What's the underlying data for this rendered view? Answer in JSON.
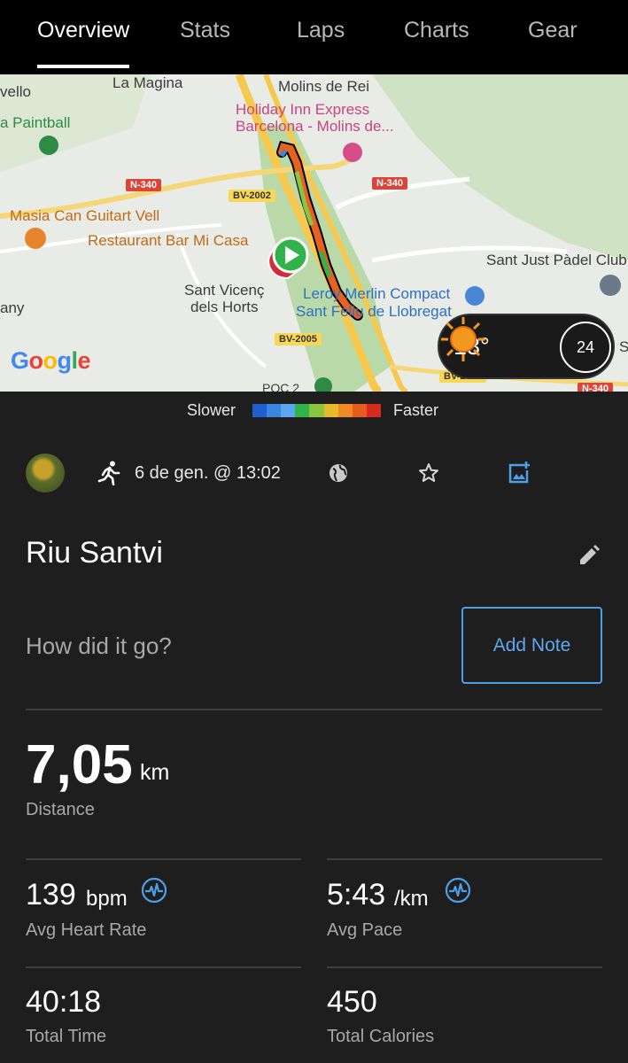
{
  "tabs": [
    {
      "label": "Overview",
      "active": true
    },
    {
      "label": "Stats"
    },
    {
      "label": "Laps"
    },
    {
      "label": "Charts"
    },
    {
      "label": "Gear"
    }
  ],
  "map": {
    "labels": {
      "la_magina": "La Magina",
      "molins_de_rei": "Molins de Rei",
      "vello": "vello",
      "paintball": "a Paintball",
      "holiday_inn_1": "Holiday Inn Express",
      "holiday_inn_2": "Barcelona - Molins de...",
      "masia": "Masia Can Guitart Vell",
      "restaurant": "Restaurant Bar Mi Casa",
      "sant_vicenc_1": "Sant Vicenç",
      "sant_vicenc_2": "dels Horts",
      "leroy_1": "Leroy Merlin Compact",
      "leroy_2": "Sant Feliu de Llobregat",
      "sant_just": "Sant Just Pàdel Club",
      "any": "any",
      "s_edge": "S"
    },
    "road_shields": {
      "n340_a": "N-340",
      "n340_b": "N-340",
      "n340_c": "N-340",
      "bv2002": "BV-2002",
      "bv2005": "BV-2005",
      "bv2001": "BV-2001",
      "poc": "POC 2"
    },
    "google_logo": "Google",
    "weather": {
      "temperature": "13°",
      "moon_phase_day": "24"
    }
  },
  "legend": {
    "slower": "Slower",
    "faster": "Faster",
    "colors": [
      "#1f5fd0",
      "#3b86e0",
      "#5aa7ef",
      "#2fb34a",
      "#8bc53f",
      "#e7b92d",
      "#f08a24",
      "#e65b1e",
      "#d62a1f"
    ]
  },
  "activity": {
    "date": "6 de gen. @ 13:02",
    "title": "Riu Santvi",
    "prompt": "How did it go?",
    "add_note_label": "Add Note",
    "distance": {
      "value": "7,05",
      "unit": "km",
      "label": "Distance"
    },
    "heart_rate": {
      "value": "139",
      "unit": "bpm",
      "label": "Avg Heart Rate"
    },
    "pace": {
      "value": "5:43",
      "unit": "/km",
      "label": "Avg Pace"
    },
    "time": {
      "value": "40:18",
      "label": "Total Time"
    },
    "calories": {
      "value": "450",
      "label": "Total Calories"
    }
  },
  "colors": {
    "accent": "#4d9fe8",
    "background": "#1e1e1e",
    "tab_bar": "#000000"
  }
}
